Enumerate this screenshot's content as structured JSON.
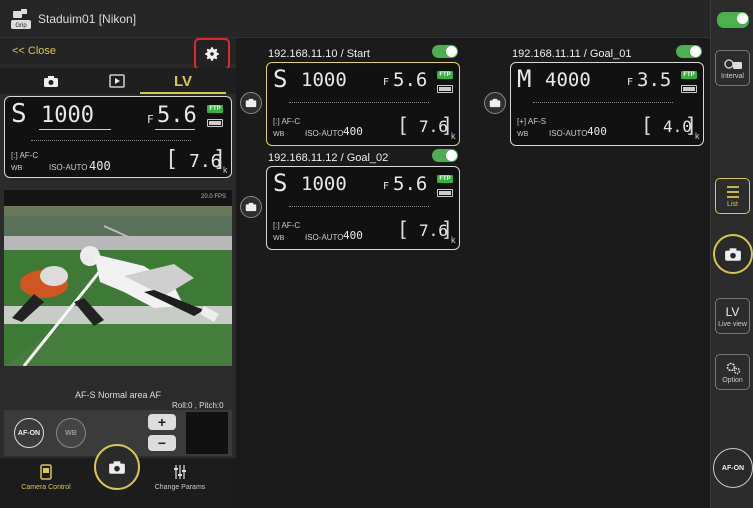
{
  "header": {
    "title": "Staduim01 [Nikon]",
    "app_icon": "grip-app-icon"
  },
  "left_panel": {
    "close_label": "<< Close",
    "tabs": [
      {
        "icon": "camera-icon"
      },
      {
        "icon": "play-icon"
      },
      {
        "label": "LV"
      }
    ],
    "lcd": {
      "mode": "S",
      "shutter": "1000",
      "f_prefix": "F",
      "aperture": "5.6",
      "ftp": "FTP",
      "af_area": "[:] AF-C",
      "wb": "WB",
      "iso_label": "ISO-AUTO",
      "iso_value": "400",
      "shots": "7.6",
      "shots_unit": "k"
    },
    "fps": "20.0 FPS",
    "af_status": "AF-S  Normal area AF",
    "roll_pitch": "Roll:0 , Pitch:0",
    "af_on_label": "AF-ON",
    "wb_button_label": "WB",
    "plus": "+",
    "minus": "−",
    "bottom_tabs": {
      "camera_control": "Camera Control",
      "change_params": "Change Params"
    }
  },
  "cameras": [
    {
      "title": "192.168.11.10 / Start",
      "mode": "S",
      "shutter": "1000",
      "f_prefix": "F",
      "aperture": "5.6",
      "ftp": "FTP",
      "af": "[:] AF-C",
      "wb": "WB",
      "iso_label": "ISO-AUTO",
      "iso_value": "400",
      "shots": "7.6",
      "shots_unit": "k"
    },
    {
      "title": "192.168.11.12 / Goal_02",
      "mode": "S",
      "shutter": "1000",
      "f_prefix": "F",
      "aperture": "5.6",
      "ftp": "FTP",
      "af": "[:] AF-C",
      "wb": "WB",
      "iso_label": "ISO-AUTO",
      "iso_value": "400",
      "shots": "7.6",
      "shots_unit": "k"
    },
    {
      "title": "192.168.11.11 / Goal_01",
      "mode": "M",
      "shutter": "4000",
      "f_prefix": "F",
      "aperture": "3.5",
      "ftp": "FTP",
      "af": "[+] AF-S",
      "wb": "WB",
      "iso_label": "ISO-AUTO",
      "iso_value": "400",
      "shots": "4.0",
      "shots_unit": "k"
    }
  ],
  "rail": {
    "interval": "Interval",
    "list": "List",
    "live_view_top": "LV",
    "live_view": "Live view",
    "option": "Option",
    "af_on": "AF-ON"
  },
  "colors": {
    "accent": "#d7c64f",
    "toggle_on": "#4caf50",
    "highlight": "#e0262b"
  }
}
